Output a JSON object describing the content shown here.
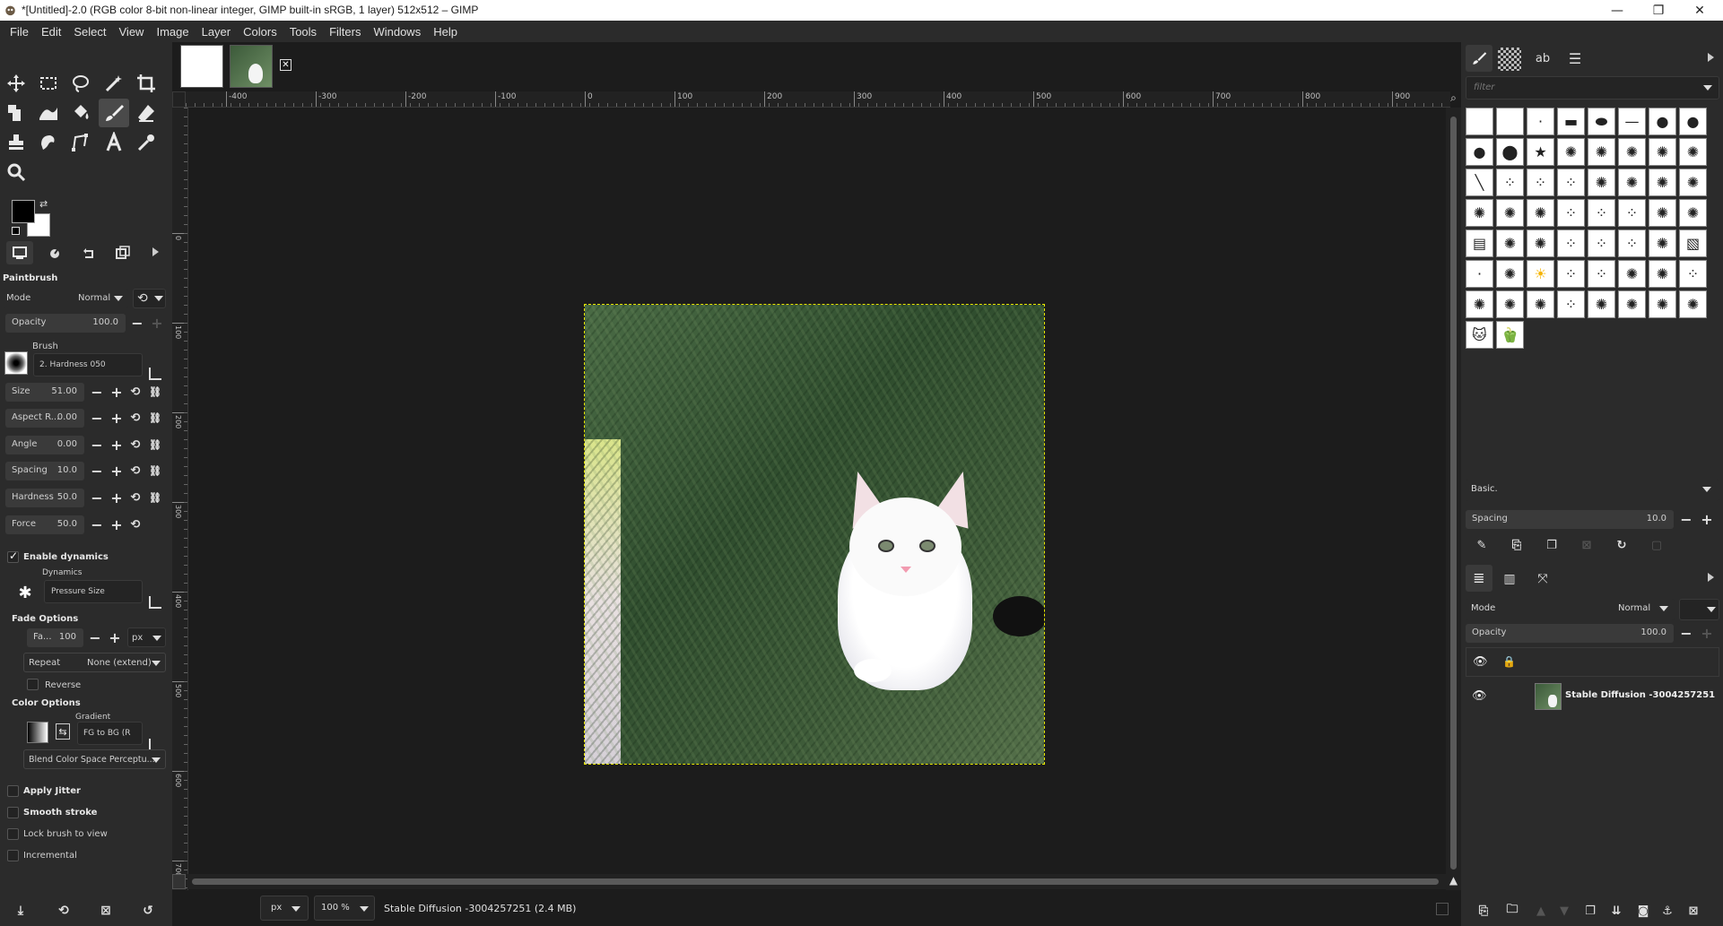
{
  "window": {
    "title": "*[Untitled]-2.0 (RGB color 8-bit non-linear integer, GIMP built-in sRGB, 1 layer) 512x512 – GIMP",
    "minimize": "—",
    "maximize": "❐",
    "close": "✕"
  },
  "menu": [
    "File",
    "Edit",
    "Select",
    "View",
    "Image",
    "Layer",
    "Colors",
    "Tools",
    "Filters",
    "Windows",
    "Help"
  ],
  "tool_options": {
    "tool_name": "Paintbrush",
    "mode_label": "Mode",
    "mode_value": "Normal",
    "opacity_label": "Opacity",
    "opacity_value": "100.0",
    "brush_label": "Brush",
    "brush_value": "2. Hardness 050",
    "size_label": "Size",
    "size_value": "51.00",
    "aspect_label": "Aspect R...",
    "aspect_value": "0.00",
    "angle_label": "Angle",
    "angle_value": "0.00",
    "spacing_label": "Spacing",
    "spacing_value": "10.0",
    "hardness_label": "Hardness",
    "hardness_value": "50.0",
    "force_label": "Force",
    "force_value": "50.0",
    "enable_dynamics": "Enable dynamics",
    "dynamics_label": "Dynamics",
    "dynamics_value": "Pressure Size",
    "fade_options": "Fade Options",
    "fade_label": "Fa...",
    "fade_value": "100",
    "fade_unit": "px",
    "repeat_label": "Repeat",
    "repeat_value": "None (extend)",
    "reverse": "Reverse",
    "color_options": "Color Options",
    "gradient_label": "Gradient",
    "gradient_value": "FG to BG (R",
    "blend_space": "Blend Color Space Perceptu...",
    "apply_jitter": "Apply Jitter",
    "smooth_stroke": "Smooth stroke",
    "lock_brush": "Lock brush to view",
    "incremental": "Incremental"
  },
  "rulers": {
    "h_ticks": [
      "-400",
      "-300",
      "-200",
      "-100",
      "0",
      "100",
      "200",
      "300",
      "400",
      "500",
      "600",
      "700",
      "800",
      "900"
    ],
    "v_ticks": [
      "0",
      "100",
      "200",
      "300",
      "400",
      "500",
      "600",
      "700"
    ]
  },
  "status": {
    "unit": "px",
    "zoom": "100 %",
    "message": "Stable Diffusion -3004257251 (2.4 MB)"
  },
  "brushes_panel": {
    "filter_placeholder": "filter",
    "preset": "Basic.",
    "spacing_label": "Spacing",
    "spacing_value": "10.0"
  },
  "layers_panel": {
    "mode_label": "Mode",
    "mode_value": "Normal",
    "opacity_label": "Opacity",
    "opacity_value": "100.0",
    "layers": [
      {
        "name": "Stable Diffusion -3004257251"
      }
    ]
  },
  "colors": {
    "accent": "#e8e800",
    "panel": "#2b2b2b",
    "canvas": "#1c1c1c"
  }
}
